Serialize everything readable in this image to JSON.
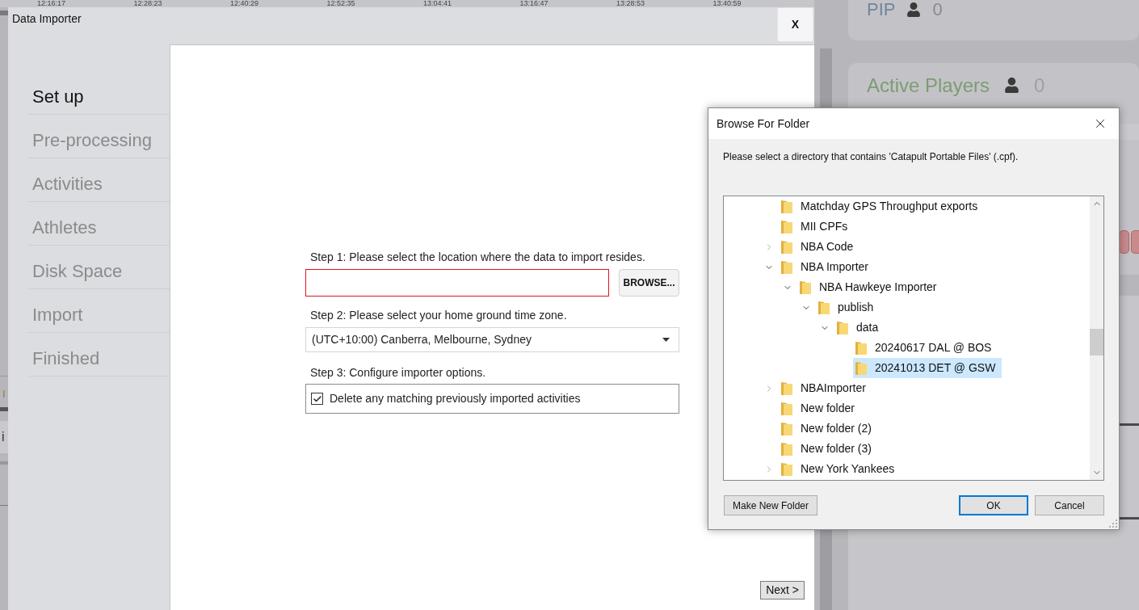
{
  "background": {
    "axis_labels": [
      "12:16:17",
      "12:28:23",
      "12:40:29",
      "12:52:35",
      "13:04:41",
      "13:16:47",
      "13:28:53",
      "13:40:59"
    ],
    "fragments": [
      "I",
      "i"
    ],
    "cards": [
      {
        "title": "PIP",
        "count": "0",
        "color": "#72859a"
      },
      {
        "title": "Active Players",
        "count": "0",
        "color": "#7e9b73"
      }
    ]
  },
  "window": {
    "title": "Data Importer",
    "close_label": "X"
  },
  "sidebar": {
    "items": [
      {
        "label": "Set up",
        "selected": true
      },
      {
        "label": "Pre-processing",
        "selected": false
      },
      {
        "label": "Activities",
        "selected": false
      },
      {
        "label": "Athletes",
        "selected": false
      },
      {
        "label": "Disk Space",
        "selected": false
      },
      {
        "label": "Import",
        "selected": false
      },
      {
        "label": "Finished",
        "selected": false
      }
    ]
  },
  "form": {
    "steps": [
      {
        "kind": "location",
        "label": "Step 1: Please select the location where the data to import resides.",
        "field": {
          "invalid": true
        },
        "button": "BROWSE..."
      },
      {
        "kind": "select",
        "label": "Step 2: Please select your home ground time zone.",
        "select": {
          "value": "(UTC+10:00) Canberra, Melbourne, Sydney"
        }
      },
      {
        "kind": "options",
        "label": "Step 3: Configure importer options.",
        "options": [
          {
            "label": "Delete any matching previously imported activities",
            "checked": true
          }
        ]
      }
    ]
  },
  "next_button": "Next >",
  "browse_dialog": {
    "title": "Browse For Folder",
    "instruction": "Please select a directory that contains 'Catapult Portable Files' (.cpf).",
    "tree": [
      {
        "label": "Matchday GPS Throughput exports",
        "selected": false
      },
      {
        "label": "MII CPFs",
        "selected": false
      },
      {
        "label": "NBA Code",
        "expanded": false,
        "selected": false
      },
      {
        "label": "NBA Importer",
        "expanded": true,
        "selected": false,
        "children": [
          {
            "label": "NBA Hawkeye Importer",
            "expanded": true,
            "selected": false,
            "children": [
              {
                "label": "publish",
                "expanded": true,
                "selected": false,
                "children": [
                  {
                    "label": "data",
                    "expanded": true,
                    "selected": false,
                    "children": [
                      {
                        "label": "20240617 DAL @ BOS",
                        "selected": false
                      },
                      {
                        "label": "20241013 DET @ GSW",
                        "selected": true
                      }
                    ]
                  }
                ]
              }
            ]
          }
        ]
      },
      {
        "label": "NBAImporter",
        "expanded": false,
        "selected": false
      },
      {
        "label": "New folder",
        "selected": false
      },
      {
        "label": "New folder (2)",
        "selected": false
      },
      {
        "label": "New folder (3)",
        "selected": false
      },
      {
        "label": "New York Yankees",
        "expanded": false,
        "selected": false
      }
    ],
    "left_buttons": [
      {
        "label": "Make New Folder",
        "default": false
      }
    ],
    "right_buttons": [
      {
        "label": "OK",
        "default": true
      },
      {
        "label": "Cancel",
        "default": false
      }
    ]
  }
}
